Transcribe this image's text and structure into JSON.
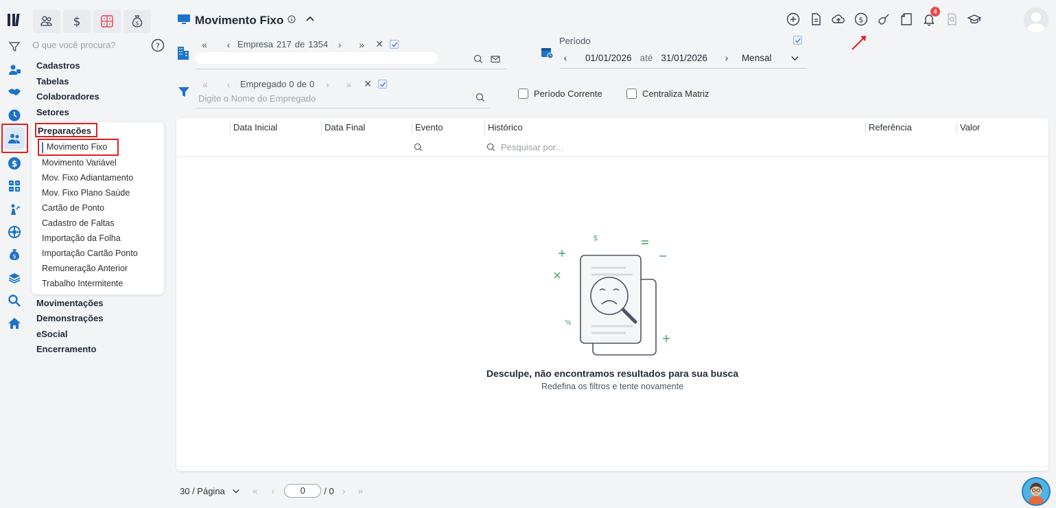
{
  "sidebar": {
    "search_placeholder": "O que você procura?",
    "menu": {
      "cadastros": "Cadastros",
      "tabelas": "Tabelas",
      "colaboradores": "Colaboradores",
      "setores": "Setores",
      "preparacoes": "Preparações",
      "movimentacoes": "Movimentações",
      "demonstracoes": "Demonstrações",
      "esocial": "eSocial",
      "encerramento": "Encerramento"
    },
    "submenu": [
      "Movimento Fixo",
      "Movimento Variável",
      "Mov. Fixo Adiantamento",
      "Mov. Fixo Plano Saúde",
      "Cartão de Ponto",
      "Cadastro de Faltas",
      "Importação da Folha",
      "Importação Cartão Ponto",
      "Remuneração Anterior",
      "Trabalho Intermitente"
    ],
    "mini_tabs": [
      "users-icon",
      "dollar-icon",
      "grid-icon",
      "money-bag-icon"
    ]
  },
  "header": {
    "title": "Movimento Fixo",
    "notification_count": "4",
    "icons": [
      "add-circle-icon",
      "document-icon",
      "cloud-upload-icon",
      "dollar-circle-icon",
      "broom-icon",
      "note-icon",
      "bell-icon",
      "search-doc-icon",
      "graduation-cap-icon"
    ]
  },
  "empresa": {
    "label": "Empresa",
    "current": "217",
    "of": "de",
    "total": "1354"
  },
  "periodo": {
    "label": "Período",
    "start": "01/01/2026",
    "between": "até",
    "end": "31/01/2026",
    "frequency": "Mensal"
  },
  "empregado": {
    "label": "Empregado",
    "current": "0",
    "of": "de",
    "total": "0",
    "placeholder": "Digite o Nome do Empregado"
  },
  "options": {
    "periodo_corrente": "Período Corrente",
    "centraliza_matriz": "Centraliza Matriz"
  },
  "table": {
    "columns": [
      "Data Inicial",
      "Data Final",
      "Evento",
      "Histórico",
      "Referência",
      "Valor"
    ],
    "search_placeholder": "Pesquisar por...",
    "empty_title": "Desculpe, não encontramos resultados para sua busca",
    "empty_subtitle": "Redefina os filtros e tente novamente"
  },
  "pagination": {
    "per_page": "30 / Página",
    "current_page": "0",
    "total_pages": "/ 0"
  },
  "colors": {
    "accent": "#3b6fd6",
    "highlight": "#e11d1d",
    "rail_icon": "#1e73c8"
  }
}
